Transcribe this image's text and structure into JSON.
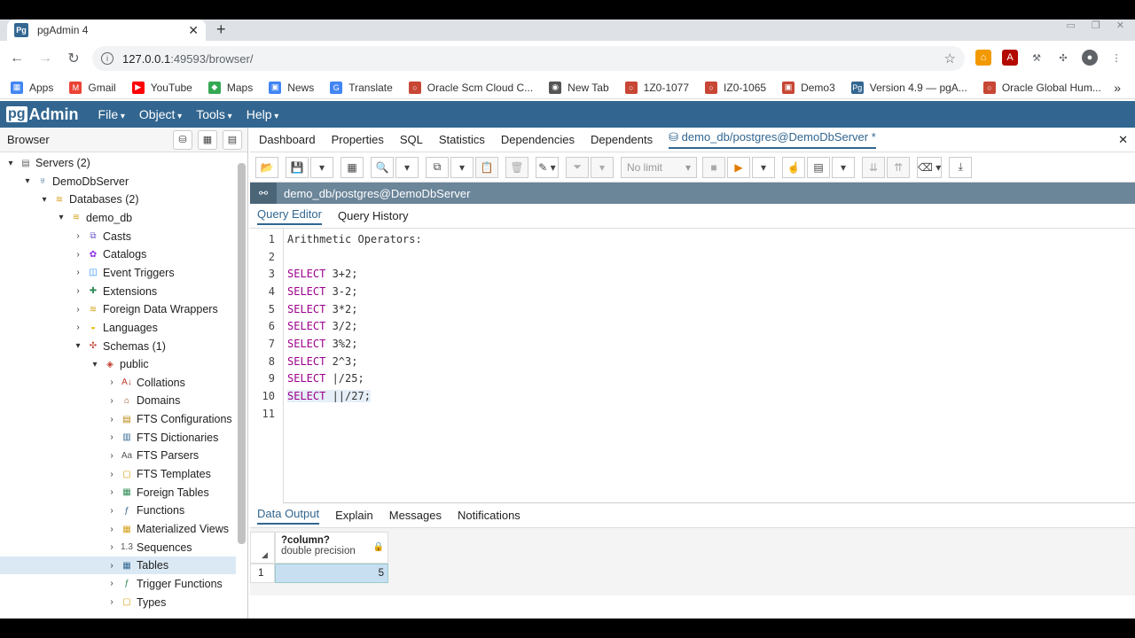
{
  "tab": {
    "title": "pgAdmin 4",
    "favicon": "Pg"
  },
  "address": {
    "host": "127.0.0.1",
    "rest": ":49593/browser/"
  },
  "bookmarks": [
    {
      "label": "Apps",
      "color": "#4285f4",
      "glyph": "▦"
    },
    {
      "label": "Gmail",
      "color": "#ea4335",
      "glyph": "M"
    },
    {
      "label": "YouTube",
      "color": "#ff0000",
      "glyph": "▶"
    },
    {
      "label": "Maps",
      "color": "#34a853",
      "glyph": "◆"
    },
    {
      "label": "News",
      "color": "#4285f4",
      "glyph": "▣"
    },
    {
      "label": "Translate",
      "color": "#4285f4",
      "glyph": "G"
    },
    {
      "label": "Oracle Scm Cloud C...",
      "color": "#c74634",
      "glyph": "○"
    },
    {
      "label": "New Tab",
      "color": "#555555",
      "glyph": "◉"
    },
    {
      "label": "1Z0-1077",
      "color": "#c74634",
      "glyph": "○"
    },
    {
      "label": "IZ0-1065",
      "color": "#c74634",
      "glyph": "○"
    },
    {
      "label": "Demo3",
      "color": "#c74634",
      "glyph": "▣"
    },
    {
      "label": "Version 4.9 — pgA...",
      "color": "#336791",
      "glyph": "Pg"
    },
    {
      "label": "Oracle Global Hum...",
      "color": "#c74634",
      "glyph": "○"
    }
  ],
  "pgadmin": {
    "logo_pg": "pg",
    "logo_admin": "Admin",
    "menu": [
      "File",
      "Object",
      "Tools",
      "Help"
    ]
  },
  "browser_panel": {
    "title": "Browser",
    "tree": [
      {
        "label": "Servers (2)",
        "indent": 0,
        "chev": "▾",
        "icon": "▤",
        "color": "#666666"
      },
      {
        "label": "DemoDbServer",
        "indent": 1,
        "chev": "▾",
        "icon": "♅",
        "color": "#336791"
      },
      {
        "label": "Databases (2)",
        "indent": 2,
        "chev": "▾",
        "icon": "≋",
        "color": "#d4a017"
      },
      {
        "label": "demo_db",
        "indent": 3,
        "chev": "▾",
        "icon": "≋",
        "color": "#d4a017"
      },
      {
        "label": "Casts",
        "indent": 4,
        "chev": "›",
        "icon": "⧉",
        "color": "#6a5acd"
      },
      {
        "label": "Catalogs",
        "indent": 4,
        "chev": "›",
        "icon": "✿",
        "color": "#8a2be2"
      },
      {
        "label": "Event Triggers",
        "indent": 4,
        "chev": "›",
        "icon": "◫",
        "color": "#1e90ff"
      },
      {
        "label": "Extensions",
        "indent": 4,
        "chev": "›",
        "icon": "✚",
        "color": "#2e8b57"
      },
      {
        "label": "Foreign Data Wrappers",
        "indent": 4,
        "chev": "›",
        "icon": "≋",
        "color": "#d4a017"
      },
      {
        "label": "Languages",
        "indent": 4,
        "chev": "›",
        "icon": "◒",
        "color": "#e6b800"
      },
      {
        "label": "Schemas (1)",
        "indent": 4,
        "chev": "▾",
        "icon": "✣",
        "color": "#c0392b"
      },
      {
        "label": "public",
        "indent": 5,
        "chev": "▾",
        "icon": "◈",
        "color": "#c0392b"
      },
      {
        "label": "Collations",
        "indent": 6,
        "chev": "›",
        "icon": "A↓",
        "color": "#c0392b"
      },
      {
        "label": "Domains",
        "indent": 6,
        "chev": "›",
        "icon": "⌂",
        "color": "#8b4513"
      },
      {
        "label": "FTS Configurations",
        "indent": 6,
        "chev": "›",
        "icon": "▤",
        "color": "#b8860b"
      },
      {
        "label": "FTS Dictionaries",
        "indent": 6,
        "chev": "›",
        "icon": "▥",
        "color": "#336791"
      },
      {
        "label": "FTS Parsers",
        "indent": 6,
        "chev": "›",
        "icon": "Aa",
        "color": "#555555"
      },
      {
        "label": "FTS Templates",
        "indent": 6,
        "chev": "›",
        "icon": "▢",
        "color": "#d4a017"
      },
      {
        "label": "Foreign Tables",
        "indent": 6,
        "chev": "›",
        "icon": "▦",
        "color": "#2e8b57"
      },
      {
        "label": "Functions",
        "indent": 6,
        "chev": "›",
        "icon": "ƒ",
        "color": "#336791"
      },
      {
        "label": "Materialized Views",
        "indent": 6,
        "chev": "›",
        "icon": "▦",
        "color": "#d4a017"
      },
      {
        "label": "Sequences",
        "indent": 6,
        "chev": "›",
        "icon": "1.3",
        "color": "#555555"
      },
      {
        "label": "Tables",
        "indent": 6,
        "chev": "›",
        "icon": "▦",
        "color": "#336791",
        "selected": true
      },
      {
        "label": "Trigger Functions",
        "indent": 6,
        "chev": "›",
        "icon": "ƒ",
        "color": "#2e8b57"
      },
      {
        "label": "Types",
        "indent": 6,
        "chev": "›",
        "icon": "▢",
        "color": "#d4a017"
      }
    ]
  },
  "main_tabs": [
    "Dashboard",
    "Properties",
    "SQL",
    "Statistics",
    "Dependencies",
    "Dependents",
    "demo_db/postgres@DemoDbServer *"
  ],
  "limit": {
    "value": "No limit"
  },
  "query_title": "demo_db/postgres@DemoDbServer",
  "query_subtabs": [
    "Query Editor",
    "Query History"
  ],
  "editor_lines": [
    {
      "n": "1",
      "kw": "",
      "rest": "Arithmetic Operators:"
    },
    {
      "n": "2",
      "kw": "",
      "rest": ""
    },
    {
      "n": "3",
      "kw": "SELECT",
      "rest": " 3+2;"
    },
    {
      "n": "4",
      "kw": "SELECT",
      "rest": " 3-2;"
    },
    {
      "n": "5",
      "kw": "SELECT",
      "rest": " 3*2;"
    },
    {
      "n": "6",
      "kw": "SELECT",
      "rest": " 3/2;"
    },
    {
      "n": "7",
      "kw": "SELECT",
      "rest": " 3%2;"
    },
    {
      "n": "8",
      "kw": "SELECT",
      "rest": " 2^3;"
    },
    {
      "n": "9",
      "kw": "SELECT",
      "rest": " |/25;"
    },
    {
      "n": "10",
      "kw": "SELECT",
      "rest": " ||/27;",
      "highlight": true
    },
    {
      "n": "11",
      "kw": "",
      "rest": ""
    }
  ],
  "result_tabs": [
    "Data Output",
    "Explain",
    "Messages",
    "Notifications"
  ],
  "result": {
    "column_name": "?column?",
    "column_type": "double precision",
    "row_num": "1",
    "value": "5"
  }
}
